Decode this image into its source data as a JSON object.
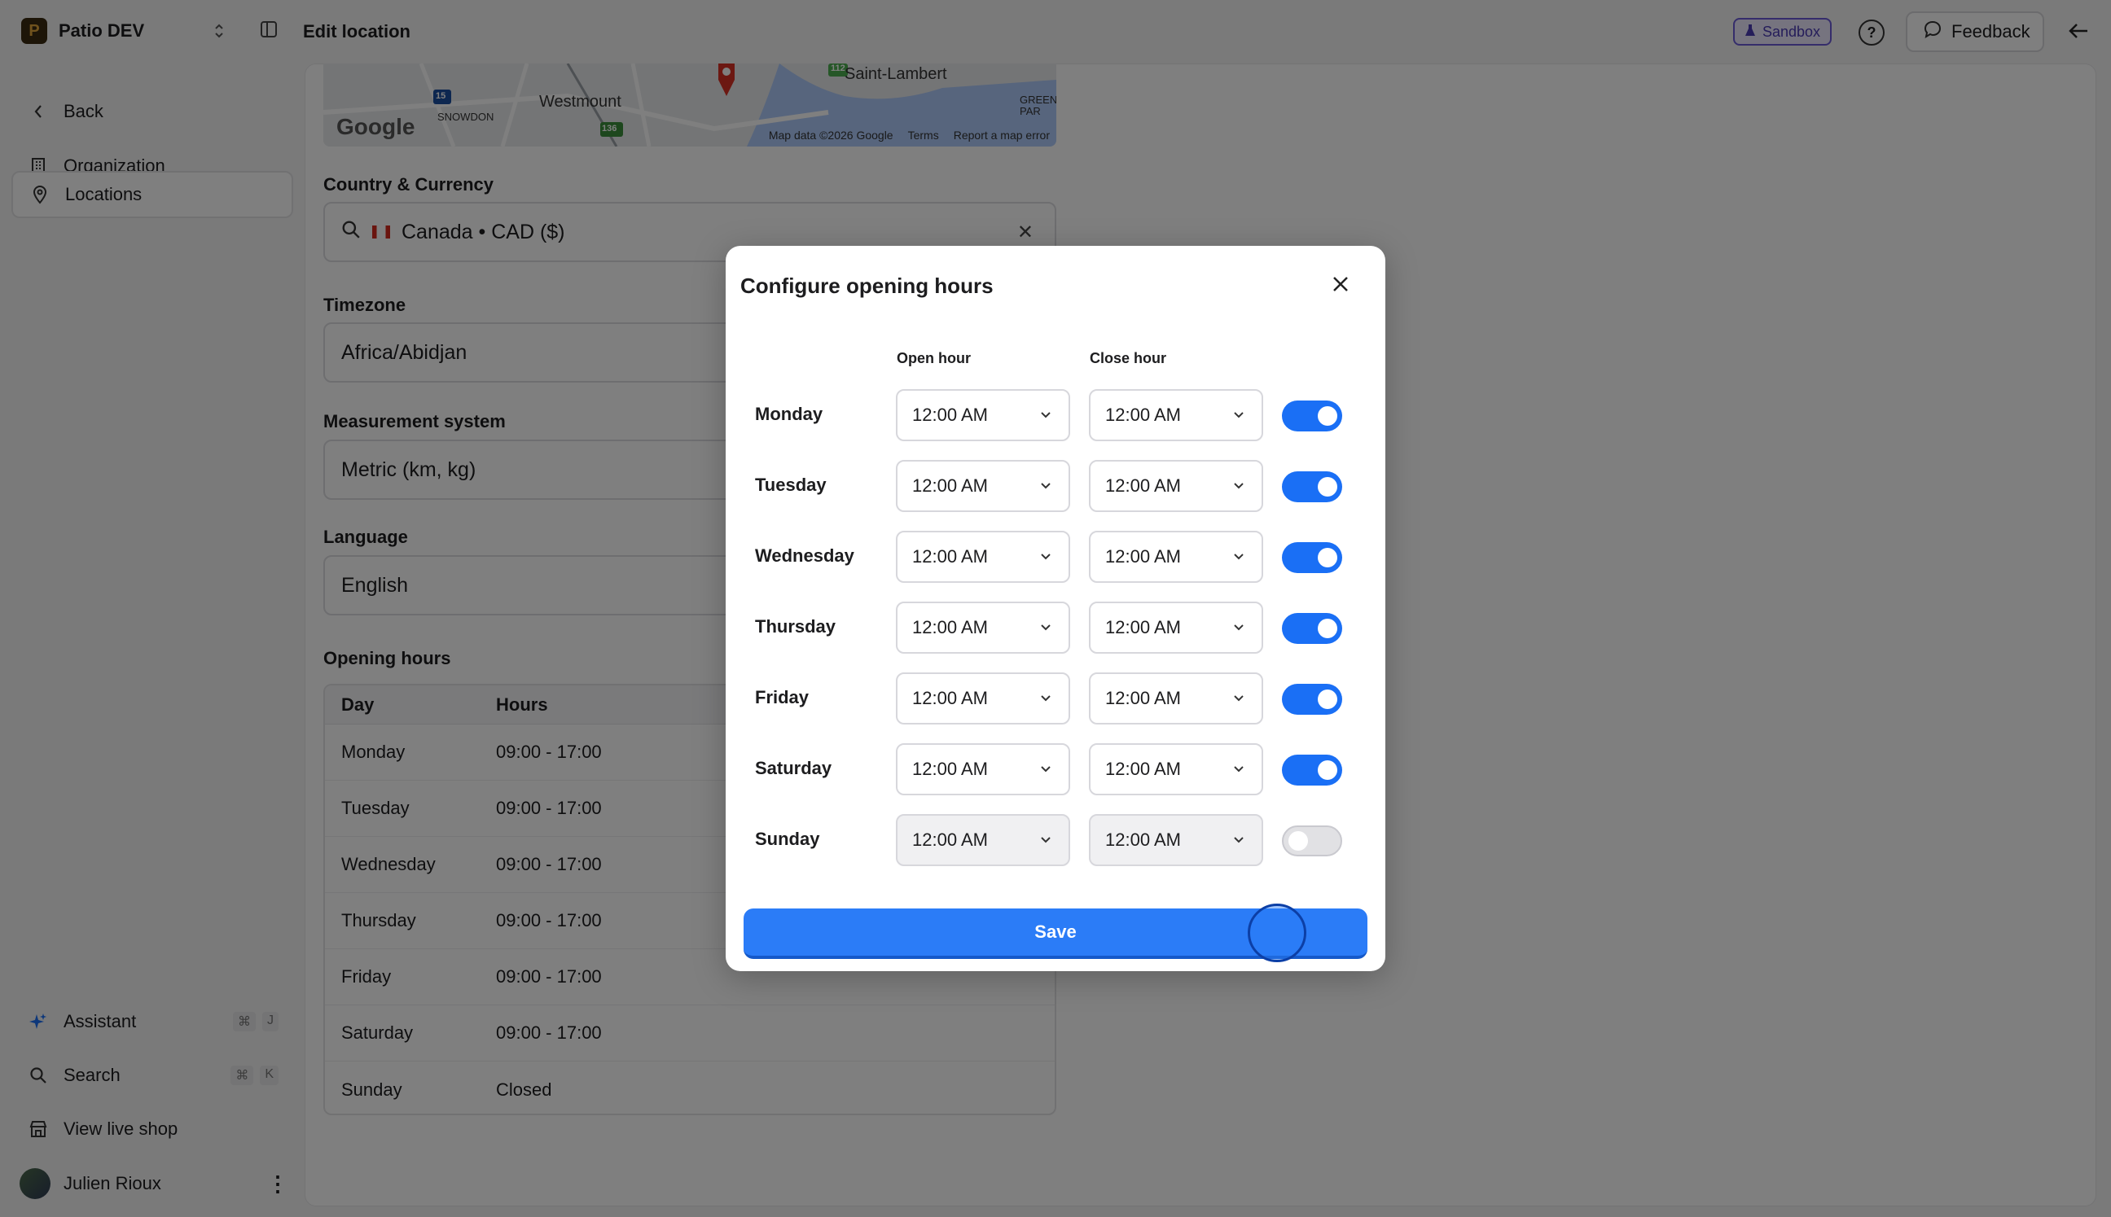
{
  "topbar": {
    "org_name": "Patio DEV",
    "page_title": "Edit location",
    "sandbox_label": "Sandbox",
    "feedback_label": "Feedback"
  },
  "sidebar": {
    "items": [
      {
        "label": "Back",
        "icon": "chevron-left-icon"
      },
      {
        "label": "Organization",
        "icon": "building-icon"
      },
      {
        "label": "Locations",
        "icon": "map-pin-icon",
        "active": true
      }
    ],
    "bottom": [
      {
        "label": "Assistant",
        "icon": "sparkle-icon",
        "shortcut": [
          "⌘",
          "J"
        ]
      },
      {
        "label": "Search",
        "icon": "search-icon",
        "shortcut": [
          "⌘",
          "K"
        ]
      },
      {
        "label": "View live shop",
        "icon": "store-icon"
      }
    ],
    "user_name": "Julien Rioux"
  },
  "map": {
    "labels": [
      "Saint-Lambert",
      "Westmount",
      "SNOWDON",
      "GREENF PAR"
    ],
    "shields": [
      "15",
      "136",
      "112"
    ],
    "google": "Google",
    "attribution": [
      "Map data ©2026 Google",
      "Terms",
      "Report a map error"
    ]
  },
  "form": {
    "country_label": "Country & Currency",
    "country_value": "Canada • CAD ($)",
    "timezone_label": "Timezone",
    "timezone_value": "Africa/Abidjan",
    "measurement_label": "Measurement system",
    "measurement_value": "Metric (km, kg)",
    "language_label": "Language",
    "language_value": "English",
    "opening_hours_label": "Opening hours"
  },
  "hours_table": {
    "headers": [
      "Day",
      "Hours"
    ],
    "rows": [
      {
        "day": "Monday",
        "hours": "09:00 - 17:00"
      },
      {
        "day": "Tuesday",
        "hours": "09:00 - 17:00"
      },
      {
        "day": "Wednesday",
        "hours": "09:00 - 17:00"
      },
      {
        "day": "Thursday",
        "hours": "09:00 - 17:00"
      },
      {
        "day": "Friday",
        "hours": "09:00 - 17:00"
      },
      {
        "day": "Saturday",
        "hours": "09:00 - 17:00"
      },
      {
        "day": "Sunday",
        "hours": "Closed"
      }
    ]
  },
  "dialog": {
    "title": "Configure opening hours",
    "open_header": "Open hour",
    "close_header": "Close hour",
    "save_label": "Save",
    "days": [
      {
        "day": "Monday",
        "open": "12:00 AM",
        "close": "12:00 AM",
        "enabled": true
      },
      {
        "day": "Tuesday",
        "open": "12:00 AM",
        "close": "12:00 AM",
        "enabled": true
      },
      {
        "day": "Wednesday",
        "open": "12:00 AM",
        "close": "12:00 AM",
        "enabled": true
      },
      {
        "day": "Thursday",
        "open": "12:00 AM",
        "close": "12:00 AM",
        "enabled": true
      },
      {
        "day": "Friday",
        "open": "12:00 AM",
        "close": "12:00 AM",
        "enabled": true
      },
      {
        "day": "Saturday",
        "open": "12:00 AM",
        "close": "12:00 AM",
        "enabled": true
      },
      {
        "day": "Sunday",
        "open": "12:00 AM",
        "close": "12:00 AM",
        "enabled": false
      }
    ]
  },
  "colors": {
    "accent": "#2b7cf7",
    "toggle_on": "#1a6ff5",
    "sandbox": "#6b5bd6"
  }
}
